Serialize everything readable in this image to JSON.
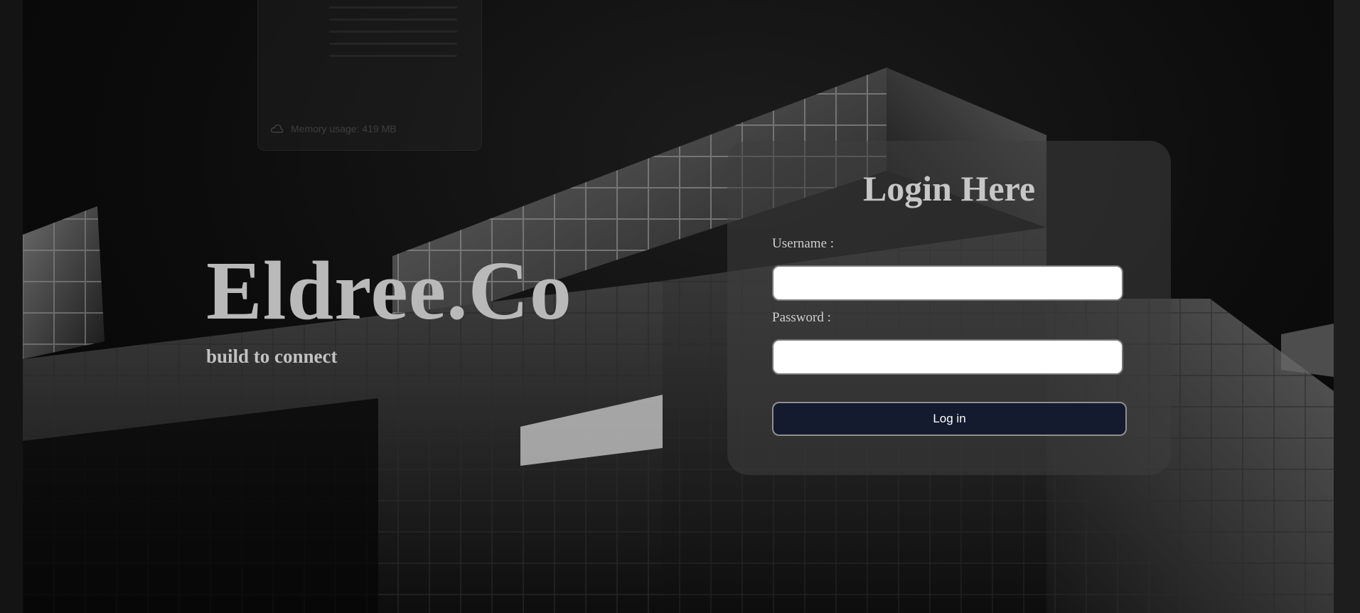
{
  "background": {
    "memory_overlay": "Memory usage: 419 MB"
  },
  "brand": {
    "name": "Eldree.Co",
    "tagline": "build to connect"
  },
  "login": {
    "title": "Login Here",
    "username_label": "Username :",
    "username_value": "",
    "password_label": "Password :",
    "password_value": "",
    "submit_label": "Log in"
  },
  "colors": {
    "button_bg": "#141b2e",
    "card_bg": "#3e3e3e",
    "brand_text": "#b9b9b9"
  }
}
